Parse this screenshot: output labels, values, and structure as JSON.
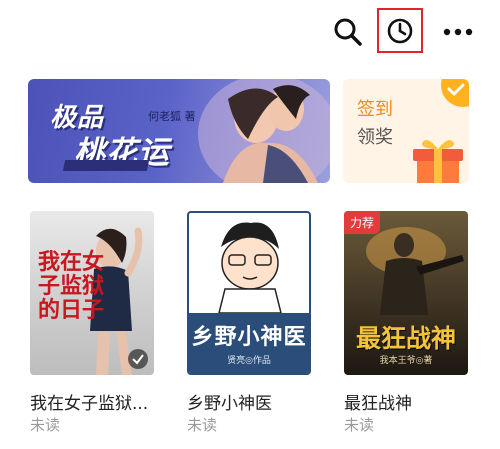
{
  "toolbar": {
    "icons": [
      "search-icon",
      "history-clock-icon",
      "more-dots-icon"
    ],
    "highlight_color": "#e0262b"
  },
  "banner": {
    "title_line1": "极品",
    "title_line2": "桃花运",
    "author": "何老狐 著"
  },
  "promo": {
    "line1": "签到",
    "line2": "领奖"
  },
  "books": [
    {
      "title": "我在女子监狱...",
      "status": "未读",
      "cover_text": "我在女子监狱的日子",
      "tag": ""
    },
    {
      "title": "乡野小神医",
      "status": "未读",
      "cover_text": "乡野小神医",
      "cover_author": "贤亮◎作品",
      "tag": ""
    },
    {
      "title": "最狂战神",
      "status": "未读",
      "cover_text": "最狂战神",
      "cover_author": "我本王爷◎著",
      "tag": "力荐"
    }
  ]
}
